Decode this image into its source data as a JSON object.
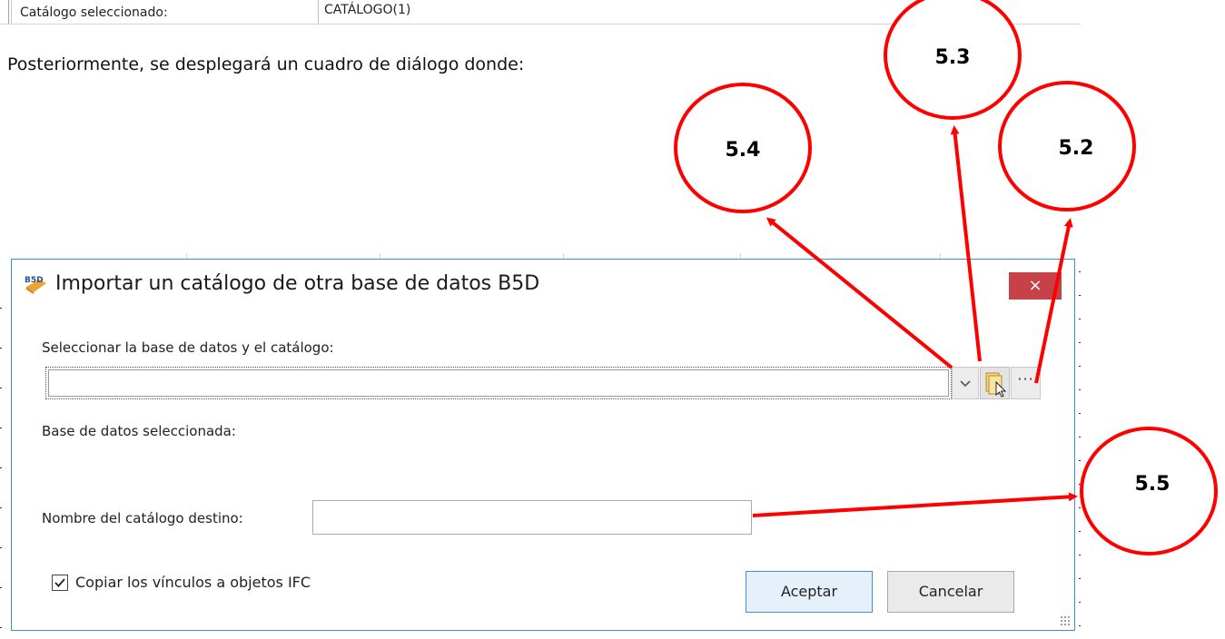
{
  "top_row": {
    "label": "Catálogo seleccionado:",
    "value": "CATÁLOGO(1)"
  },
  "intro": "Posteriormente, se desplegará un cuadro de diálogo donde:",
  "dialog": {
    "logo_text": "B5D",
    "title": "Importar un catálogo de otra base de datos B5D",
    "close_label": "×",
    "select_label": "Seleccionar la base de datos y el catálogo:",
    "select_value": "",
    "browse_label": "···",
    "selected_db_label": "Base de datos seleccionada:",
    "target_name_label": "Nombre del catálogo destino:",
    "target_name_value": "",
    "copy_links_label": "Copiar los vínculos a objetos IFC",
    "copy_links_checked": true,
    "accept_label": "Aceptar",
    "cancel_label": "Cancelar"
  },
  "callouts": {
    "c53": "5.3",
    "c54": "5.4",
    "c52": "5.2",
    "c55": "5.5"
  },
  "colors": {
    "annotation": "#ff0000",
    "dialog_border": "#3c8fd9",
    "close_button": "#c74149"
  }
}
